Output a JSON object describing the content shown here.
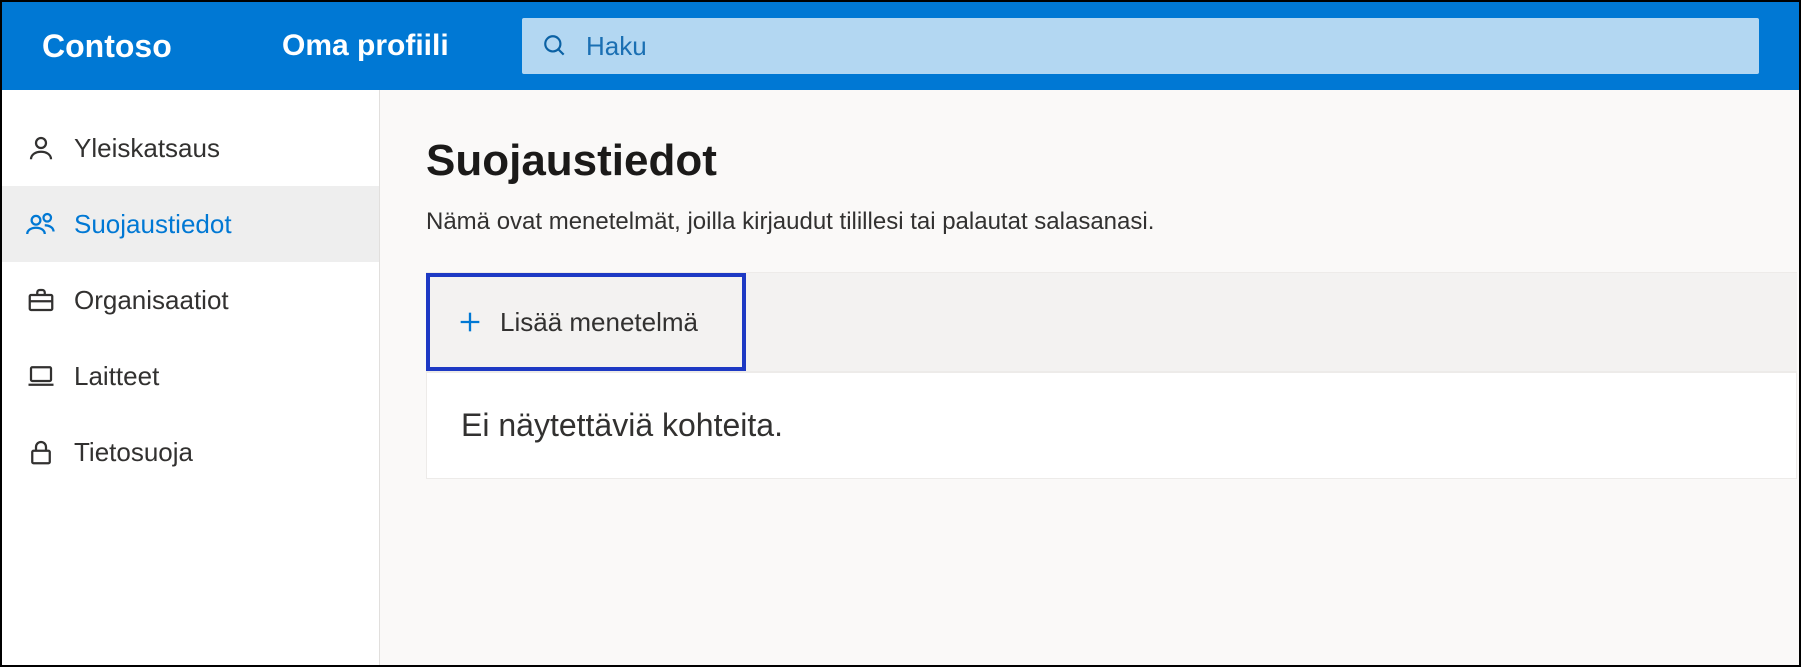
{
  "header": {
    "brand": "Contoso",
    "profile": "Oma profiili",
    "search_placeholder": "Haku"
  },
  "sidebar": {
    "items": [
      {
        "label": "Yleiskatsaus"
      },
      {
        "label": "Suojaustiedot"
      },
      {
        "label": "Organisaatiot"
      },
      {
        "label": "Laitteet"
      },
      {
        "label": "Tietosuoja"
      }
    ]
  },
  "main": {
    "title": "Suojaustiedot",
    "subtitle": "Nämä ovat menetelmät, joilla kirjaudut tilillesi tai palautat salasanasi.",
    "add_method": "Lisää menetelmä",
    "empty": "Ei näytettäviä kohteita."
  },
  "colors": {
    "accent": "#0078d4",
    "highlight_border": "#1d39c4"
  }
}
